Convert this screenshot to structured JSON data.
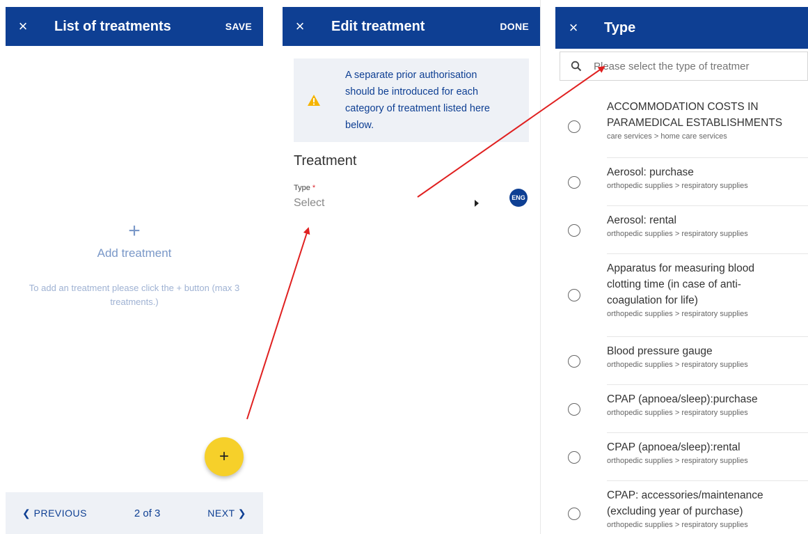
{
  "panel_list": {
    "title": "List of treatments",
    "save_label": "SAVE",
    "close_icon": "×",
    "add_icon": "+",
    "add_label": "Add treatment",
    "hint": "To add an treatment please click the + button (max 3 treatments.)",
    "fab_icon": "+",
    "prev_label": "❮ PREVIOUS",
    "page_indicator": "2 of 3",
    "next_label": "NEXT ❯"
  },
  "panel_edit": {
    "title": "Edit treatment",
    "done_label": "DONE",
    "close_icon": "×",
    "notice": "A separate prior authorisation should be introduced for each category of treatment listed here below.",
    "section_title": "Treatment",
    "type_label": "Type",
    "required_mark": "*",
    "type_placeholder": "Select",
    "lang_badge": "ENG"
  },
  "panel_type": {
    "title": "Type",
    "close_icon": "×",
    "search_placeholder": "Please select the type of treatmer",
    "options": [
      {
        "name": "ACCOMMODATION COSTS IN PARAMEDICAL ESTABLISHMENTS",
        "path": "care services > home care services"
      },
      {
        "name": "Aerosol: purchase",
        "path": "orthopedic supplies > respiratory supplies"
      },
      {
        "name": "Aerosol: rental",
        "path": "orthopedic supplies > respiratory supplies"
      },
      {
        "name": "Apparatus for measuring blood clotting time (in case of anti-coagulation for life)",
        "path": "orthopedic supplies > respiratory supplies"
      },
      {
        "name": "Blood pressure gauge",
        "path": "orthopedic supplies > respiratory supplies"
      },
      {
        "name": "CPAP (apnoea/sleep):purchase",
        "path": "orthopedic supplies > respiratory supplies"
      },
      {
        "name": "CPAP (apnoea/sleep):rental",
        "path": "orthopedic supplies > respiratory supplies"
      },
      {
        "name": "CPAP: accessories/maintenance (excluding year of purchase)",
        "path": "orthopedic supplies > respiratory supplies"
      }
    ]
  },
  "colors": {
    "header_blue": "#0e3f93",
    "fab_yellow": "#f6d02a",
    "warning": "#f5b400",
    "arrow_red": "#e02020"
  }
}
